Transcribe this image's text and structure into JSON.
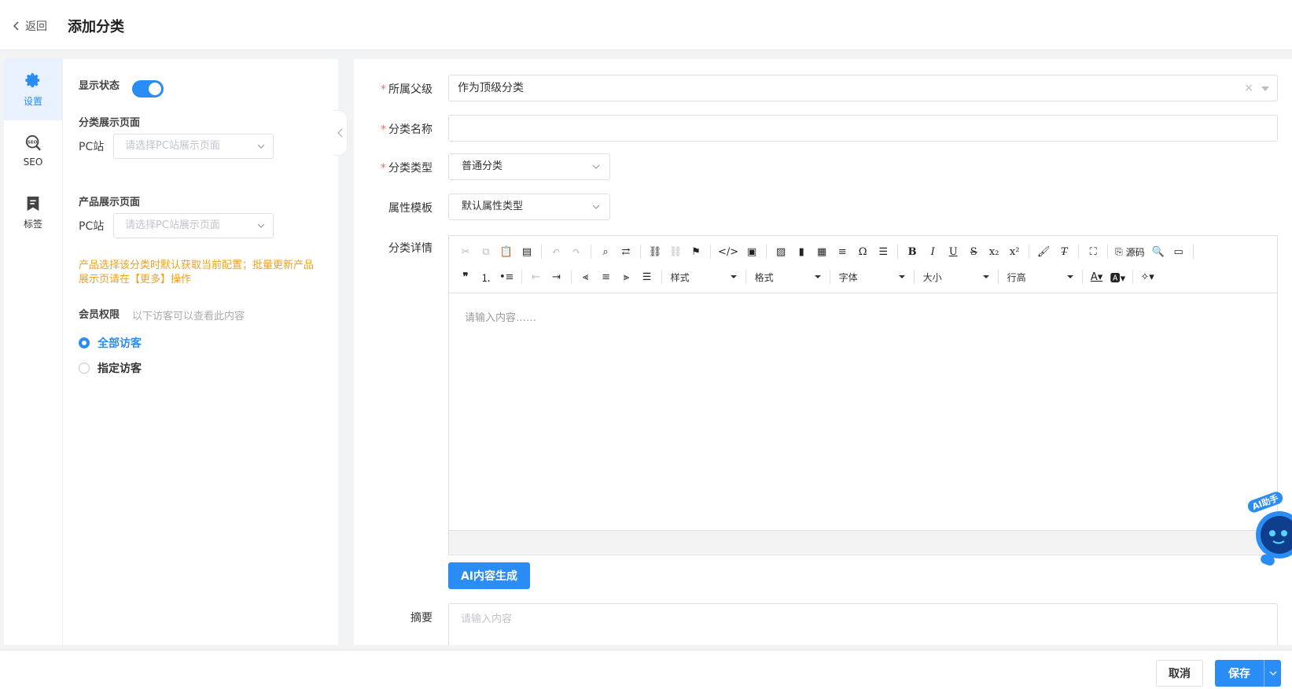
{
  "header": {
    "back_label": "返回",
    "title": "添加分类"
  },
  "sidenav": [
    {
      "label": "设置",
      "icon": "gear-icon"
    },
    {
      "label": "SEO",
      "icon": "seo-icon"
    },
    {
      "label": "标签",
      "icon": "bookmark-icon"
    }
  ],
  "left": {
    "display_status_label": "显示状态",
    "display_status_on": true,
    "category_page_title": "分类展示页面",
    "product_page_title": "产品展示页面",
    "pc_label": "PC站",
    "pc_placeholder": "请选择PC站展示页面",
    "notice": "产品选择该分类时默认获取当前配置；批量更新产品展示页请在【更多】操作",
    "member_label": "会员权限",
    "member_hint": "以下访客可以查看此内容",
    "radio_all": "全部访客",
    "radio_specific": "指定访客"
  },
  "form": {
    "parent_label": "所属父级",
    "parent_value": "作为顶级分类",
    "name_label": "分类名称",
    "name_value": "",
    "type_label": "分类类型",
    "type_value": "普通分类",
    "template_label": "属性模板",
    "template_value": "默认属性类型",
    "detail_label": "分类详情",
    "editor_placeholder": "请输入内容……",
    "source_label": "源码",
    "dd_style": "样式",
    "dd_format": "格式",
    "dd_font": "字体",
    "dd_size": "大小",
    "dd_lineheight": "行高",
    "ai_button": "AI内容生成",
    "summary_label": "摘要",
    "summary_placeholder": "请输入内容"
  },
  "footer": {
    "cancel": "取消",
    "save": "保存"
  },
  "ai_assistant": {
    "label": "AI助手"
  },
  "colors": {
    "primary": "#2a8cf5",
    "warning": "#f0a020",
    "required": "#f56c6c"
  }
}
